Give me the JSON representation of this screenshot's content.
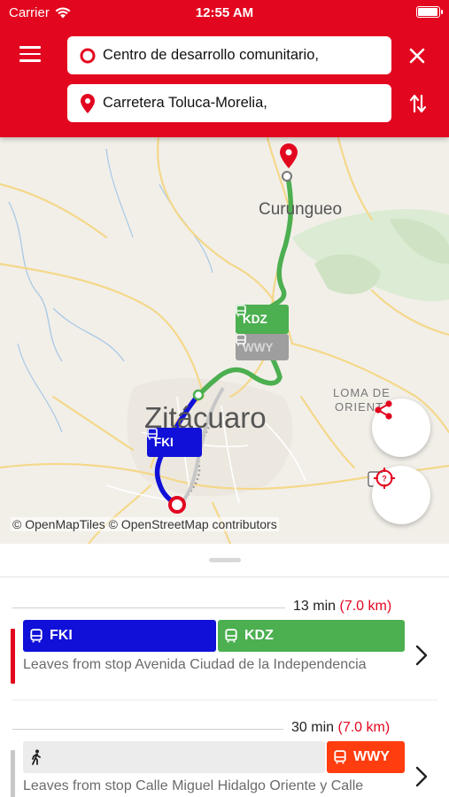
{
  "status_bar": {
    "carrier": "Carrier",
    "time": "12:55 AM",
    "battery_level": 1.0
  },
  "search": {
    "from_value": "Centro de desarrollo comunitario,",
    "to_value": "Carretera Toluca-Morelia,"
  },
  "map": {
    "place_labels": [
      "Curungueo",
      "Zitácuaro",
      "LOMA DE",
      "ORIENTE"
    ],
    "route_labels": {
      "kdz": "KDZ",
      "wwy": "WWY",
      "fki": "FKI"
    },
    "attribution": "© OpenMapTiles © OpenStreetMap contributors",
    "colors": {
      "kdz": "#4caf50",
      "fki": "#1010d8",
      "wwy_on_map": "#9e9e9e",
      "accent": "#e3061f"
    }
  },
  "results": [
    {
      "duration": "13 min",
      "distance": "(7.0 km)",
      "accent_color": "#e3061f",
      "legs": [
        {
          "kind": "bus",
          "label": "FKI",
          "color": "#1010d8"
        },
        {
          "kind": "bus",
          "label": "KDZ",
          "color": "#4caf50"
        }
      ],
      "description": "Leaves from stop Avenida Ciudad de la Independencia"
    },
    {
      "duration": "30 min",
      "distance": "(7.0 km)",
      "accent_color": "#c8c8c8",
      "legs": [
        {
          "kind": "walk",
          "label": "",
          "color": "#ececec"
        },
        {
          "kind": "bus",
          "label": "WWY",
          "color": "#ff3d0f"
        }
      ],
      "description": "Leaves from stop Calle Miguel Hidalgo Oriente y Calle"
    }
  ]
}
